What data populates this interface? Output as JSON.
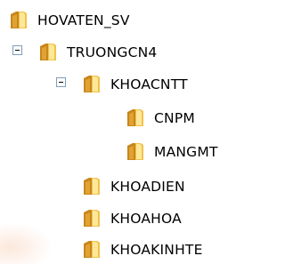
{
  "tree": {
    "nodes": [
      {
        "label": "HOVATEN_SV",
        "level": 0,
        "expanded": false,
        "has_children": false
      },
      {
        "label": "TRUONGCN4",
        "level": 0,
        "expanded": true,
        "has_children": true
      },
      {
        "label": "KHOACNTT",
        "level": 1,
        "expanded": true,
        "has_children": true
      },
      {
        "label": "CNPM",
        "level": 2,
        "expanded": false,
        "has_children": false
      },
      {
        "label": "MANGMT",
        "level": 2,
        "expanded": false,
        "has_children": false
      },
      {
        "label": "KHOADIEN",
        "level": 1,
        "expanded": false,
        "has_children": false
      },
      {
        "label": "KHOAHOA",
        "level": 1,
        "expanded": false,
        "has_children": false
      },
      {
        "label": "KHOAKINHTE",
        "level": 1,
        "expanded": false,
        "has_children": false
      }
    ]
  },
  "icons": {
    "node": "folder-icon",
    "expander": "collapse-minus-icon"
  },
  "colors": {
    "folder_body": "#f2c24a",
    "folder_dark": "#c8861a",
    "folder_light": "#fde79a",
    "expander_border": "#7f9db9"
  }
}
